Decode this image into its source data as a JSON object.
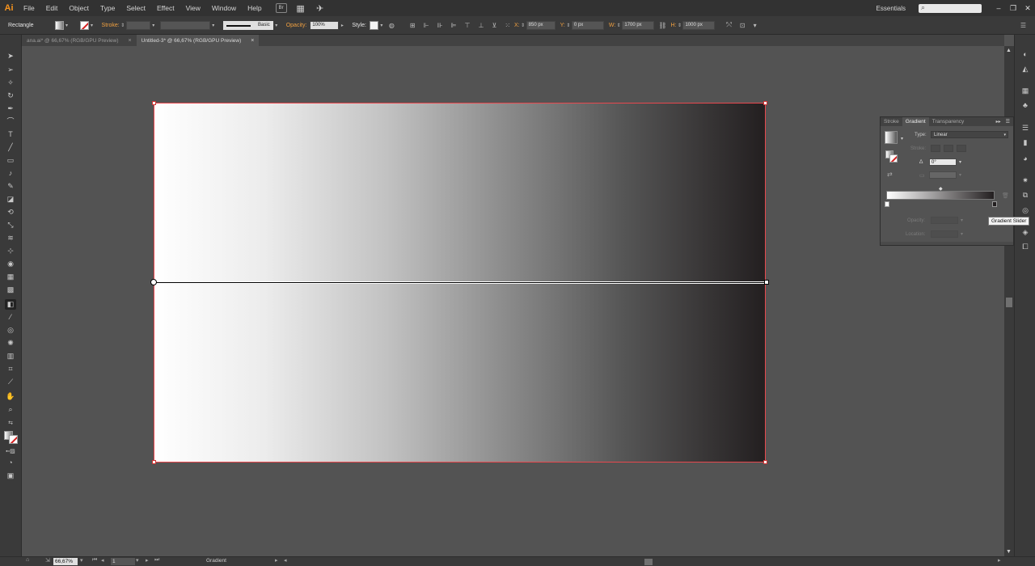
{
  "menubar": {
    "logo": "Ai",
    "items": [
      "File",
      "Edit",
      "Object",
      "Type",
      "Select",
      "Effect",
      "View",
      "Window",
      "Help"
    ],
    "bridge_label": "Br",
    "workspace": "Essentials",
    "search_placeholder": ""
  },
  "controlbar": {
    "selection_label": "Rectangle",
    "stroke_label": "Stroke:",
    "brush_label": "Basic",
    "opacity_label": "Opacity:",
    "opacity_value": "100%",
    "style_label": "Style:",
    "x_label": "X:",
    "x_value": "850 px",
    "y_label": "Y:",
    "y_value": "0 px",
    "w_label": "W:",
    "w_value": "1700 px",
    "h_label": "H:",
    "h_value": "1000 px"
  },
  "tabs": [
    {
      "label": "ana.ai* @ 66,67% (RGB/GPU Preview)",
      "active": false
    },
    {
      "label": "Untitled-3* @ 66,67% (RGB/GPU Preview)",
      "active": true
    }
  ],
  "gradient_panel": {
    "tabs": [
      "Stroke",
      "Gradient",
      "Transparency"
    ],
    "type_label": "Type:",
    "type_value": "Linear",
    "stroke_label": "Stroke:",
    "angle_value": "0°",
    "opacity_label": "Opacity:",
    "location_label": "Location:",
    "ramp_start_color": "#ffffff",
    "ramp_end_color": "#231f20"
  },
  "tooltip": "Gradient Slider",
  "statusbar": {
    "zoom": "66,67%",
    "artboard": "1",
    "current_tool": "Gradient"
  },
  "colors": {
    "accent": "#f7941e",
    "artboard_border": "#e8484e",
    "menubar_bg": "#323232",
    "panel_bg": "#535353"
  }
}
